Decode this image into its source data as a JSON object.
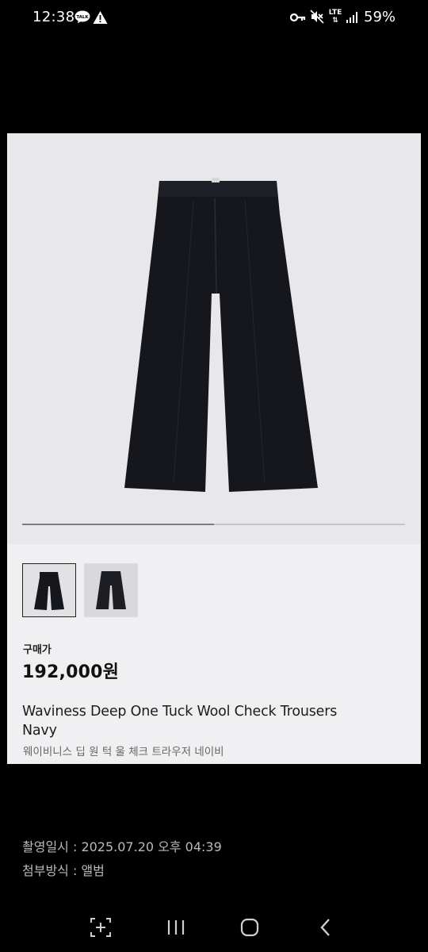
{
  "status_bar": {
    "time": "12:38",
    "talk_badge": "TALK",
    "lte": "LTE",
    "battery": "59%"
  },
  "product": {
    "image_progress": 0.5,
    "price_label": "구매가",
    "price": "192,000원",
    "name_en": "Waviness Deep One Tuck Wool Check Trousers Navy",
    "name_kr": "웨이비니스 딥 원 턱 울 체크 트라우저 네이비",
    "thumbnails": [
      "thumbnail-1",
      "thumbnail-2"
    ]
  },
  "meta": {
    "capture_date": "촬영일시 : 2025.07.20 오후 04:39",
    "attach_method": "첨부방식 : 앨범"
  },
  "icons": {
    "status": [
      "kakaotalk-icon",
      "warning-icon",
      "key-icon",
      "mute-icon",
      "lte-icon",
      "signal-icon"
    ],
    "navigation": [
      "screen-capture-icon",
      "recents-icon",
      "home-icon",
      "back-icon"
    ]
  },
  "colors": {
    "background": "#000000",
    "card_background": "#f0f0f2",
    "pants": "#15171c"
  }
}
